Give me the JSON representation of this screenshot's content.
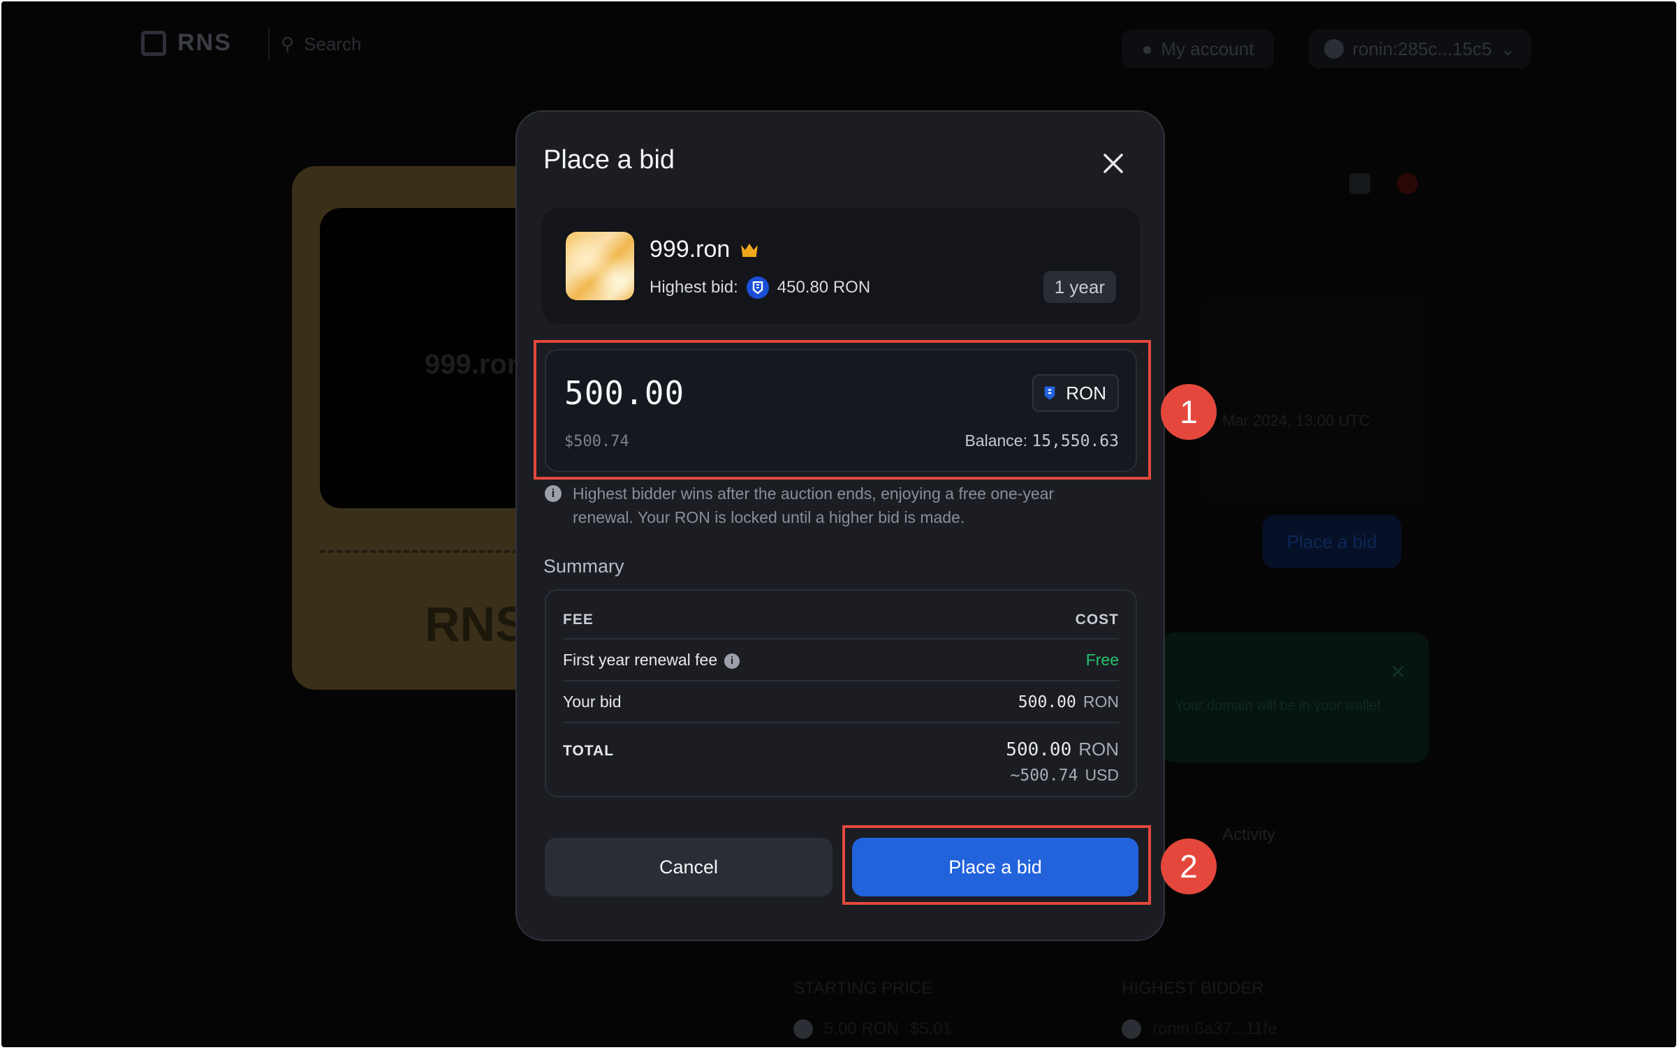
{
  "background": {
    "logo": "RNS",
    "search": "Search",
    "account": "My account",
    "wallet": "ronin:285c...15c5",
    "card_name": "999.ron",
    "card_footer": "RNS",
    "right_date": "Mar 2024, 13:00 UTC",
    "place_bid": "Place a bid",
    "notice": "Your domain will be in your wallet",
    "activity": "Activity",
    "col_left": "STARTING PRICE",
    "col_right": "HIGHEST BIDDER",
    "val_left": "5.00 RON",
    "val_left_usd": "$5.01",
    "val_right": "ronin:6a37...11fe"
  },
  "modal": {
    "title": "Place a bid",
    "item": {
      "name": "999.ron",
      "highest_bid_label": "Highest bid:",
      "highest_bid_value": "450.80 RON",
      "duration": "1 year"
    },
    "amount": {
      "value": "500.00",
      "usd": "$500.74",
      "token": "RON",
      "balance_label": "Balance:",
      "balance_value": "15,550.63"
    },
    "hint": "Highest bidder wins after the auction ends, enjoying a free one-year renewal. Your RON is locked until a higher bid is made.",
    "summary": {
      "label": "Summary",
      "col_fee": "FEE",
      "col_cost": "COST",
      "rows": [
        {
          "label": "First year renewal fee",
          "value": "Free"
        },
        {
          "label": "Your bid",
          "value": "500.00",
          "unit": "RON"
        }
      ],
      "total_label": "TOTAL",
      "total_value": "500.00",
      "total_unit": "RON",
      "total_usd_value": "~500.74",
      "total_usd_unit": "USD"
    },
    "cancel_label": "Cancel",
    "submit_label": "Place a bid"
  },
  "annotations": [
    "1",
    "2"
  ],
  "colors": {
    "accent": "#2263db",
    "free": "#27c46b",
    "annotation": "#e4483c"
  }
}
